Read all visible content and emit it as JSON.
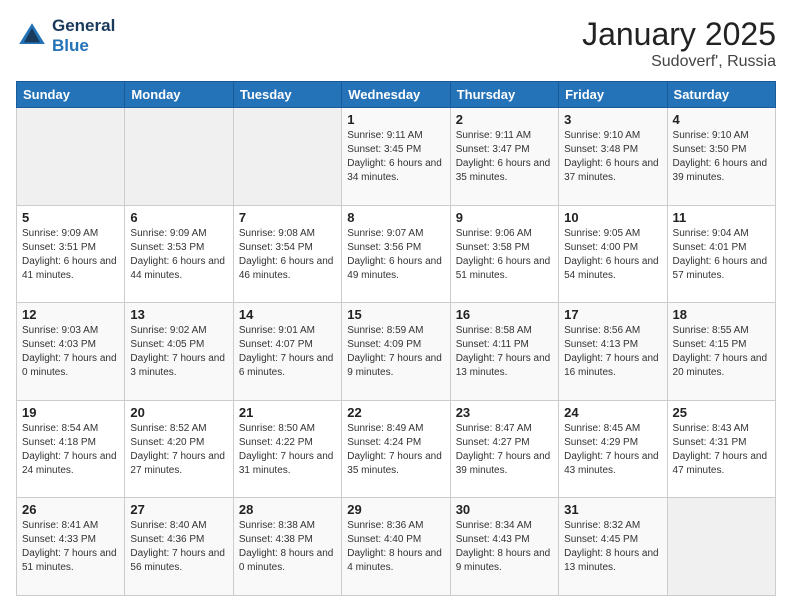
{
  "logo": {
    "line1": "General",
    "line2": "Blue"
  },
  "title": "January 2025",
  "location": "Sudoverf', Russia",
  "days_header": [
    "Sunday",
    "Monday",
    "Tuesday",
    "Wednesday",
    "Thursday",
    "Friday",
    "Saturday"
  ],
  "weeks": [
    [
      {
        "num": "",
        "info": ""
      },
      {
        "num": "",
        "info": ""
      },
      {
        "num": "",
        "info": ""
      },
      {
        "num": "1",
        "info": "Sunrise: 9:11 AM\nSunset: 3:45 PM\nDaylight: 6 hours and 34 minutes."
      },
      {
        "num": "2",
        "info": "Sunrise: 9:11 AM\nSunset: 3:47 PM\nDaylight: 6 hours and 35 minutes."
      },
      {
        "num": "3",
        "info": "Sunrise: 9:10 AM\nSunset: 3:48 PM\nDaylight: 6 hours and 37 minutes."
      },
      {
        "num": "4",
        "info": "Sunrise: 9:10 AM\nSunset: 3:50 PM\nDaylight: 6 hours and 39 minutes."
      }
    ],
    [
      {
        "num": "5",
        "info": "Sunrise: 9:09 AM\nSunset: 3:51 PM\nDaylight: 6 hours and 41 minutes."
      },
      {
        "num": "6",
        "info": "Sunrise: 9:09 AM\nSunset: 3:53 PM\nDaylight: 6 hours and 44 minutes."
      },
      {
        "num": "7",
        "info": "Sunrise: 9:08 AM\nSunset: 3:54 PM\nDaylight: 6 hours and 46 minutes."
      },
      {
        "num": "8",
        "info": "Sunrise: 9:07 AM\nSunset: 3:56 PM\nDaylight: 6 hours and 49 minutes."
      },
      {
        "num": "9",
        "info": "Sunrise: 9:06 AM\nSunset: 3:58 PM\nDaylight: 6 hours and 51 minutes."
      },
      {
        "num": "10",
        "info": "Sunrise: 9:05 AM\nSunset: 4:00 PM\nDaylight: 6 hours and 54 minutes."
      },
      {
        "num": "11",
        "info": "Sunrise: 9:04 AM\nSunset: 4:01 PM\nDaylight: 6 hours and 57 minutes."
      }
    ],
    [
      {
        "num": "12",
        "info": "Sunrise: 9:03 AM\nSunset: 4:03 PM\nDaylight: 7 hours and 0 minutes."
      },
      {
        "num": "13",
        "info": "Sunrise: 9:02 AM\nSunset: 4:05 PM\nDaylight: 7 hours and 3 minutes."
      },
      {
        "num": "14",
        "info": "Sunrise: 9:01 AM\nSunset: 4:07 PM\nDaylight: 7 hours and 6 minutes."
      },
      {
        "num": "15",
        "info": "Sunrise: 8:59 AM\nSunset: 4:09 PM\nDaylight: 7 hours and 9 minutes."
      },
      {
        "num": "16",
        "info": "Sunrise: 8:58 AM\nSunset: 4:11 PM\nDaylight: 7 hours and 13 minutes."
      },
      {
        "num": "17",
        "info": "Sunrise: 8:56 AM\nSunset: 4:13 PM\nDaylight: 7 hours and 16 minutes."
      },
      {
        "num": "18",
        "info": "Sunrise: 8:55 AM\nSunset: 4:15 PM\nDaylight: 7 hours and 20 minutes."
      }
    ],
    [
      {
        "num": "19",
        "info": "Sunrise: 8:54 AM\nSunset: 4:18 PM\nDaylight: 7 hours and 24 minutes."
      },
      {
        "num": "20",
        "info": "Sunrise: 8:52 AM\nSunset: 4:20 PM\nDaylight: 7 hours and 27 minutes."
      },
      {
        "num": "21",
        "info": "Sunrise: 8:50 AM\nSunset: 4:22 PM\nDaylight: 7 hours and 31 minutes."
      },
      {
        "num": "22",
        "info": "Sunrise: 8:49 AM\nSunset: 4:24 PM\nDaylight: 7 hours and 35 minutes."
      },
      {
        "num": "23",
        "info": "Sunrise: 8:47 AM\nSunset: 4:27 PM\nDaylight: 7 hours and 39 minutes."
      },
      {
        "num": "24",
        "info": "Sunrise: 8:45 AM\nSunset: 4:29 PM\nDaylight: 7 hours and 43 minutes."
      },
      {
        "num": "25",
        "info": "Sunrise: 8:43 AM\nSunset: 4:31 PM\nDaylight: 7 hours and 47 minutes."
      }
    ],
    [
      {
        "num": "26",
        "info": "Sunrise: 8:41 AM\nSunset: 4:33 PM\nDaylight: 7 hours and 51 minutes."
      },
      {
        "num": "27",
        "info": "Sunrise: 8:40 AM\nSunset: 4:36 PM\nDaylight: 7 hours and 56 minutes."
      },
      {
        "num": "28",
        "info": "Sunrise: 8:38 AM\nSunset: 4:38 PM\nDaylight: 8 hours and 0 minutes."
      },
      {
        "num": "29",
        "info": "Sunrise: 8:36 AM\nSunset: 4:40 PM\nDaylight: 8 hours and 4 minutes."
      },
      {
        "num": "30",
        "info": "Sunrise: 8:34 AM\nSunset: 4:43 PM\nDaylight: 8 hours and 9 minutes."
      },
      {
        "num": "31",
        "info": "Sunrise: 8:32 AM\nSunset: 4:45 PM\nDaylight: 8 hours and 13 minutes."
      },
      {
        "num": "",
        "info": ""
      }
    ]
  ]
}
